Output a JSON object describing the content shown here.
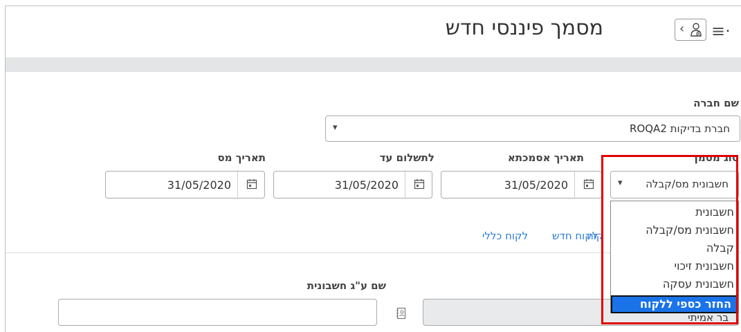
{
  "header": {
    "title": "מסמך פיננסי חדש",
    "menu_icon": "hamburger-menu-icon",
    "customer_icon": "person-add-icon"
  },
  "form": {
    "company": {
      "label": "שם חברה",
      "value": "חברת בדיקות ROQA2"
    },
    "doc_type": {
      "label": "סוג מסמך",
      "value": "חשבונית מס/קבלה"
    },
    "ref_date": {
      "label": "תאריך אסמכתא",
      "value": "31/05/2020"
    },
    "due_date": {
      "label": "לתשלום עד",
      "value": "31/05/2020"
    },
    "tax_date": {
      "label": "תאריך מס",
      "value": "31/05/2020"
    },
    "links": {
      "new_customer": "לקוח חדש",
      "general_customer": "לקוח כללי",
      "partial": "קוח"
    },
    "invoice_name": {
      "label": "שם ע\"ג חשבונית",
      "value": ""
    },
    "customer_field": {
      "value": "בר אמיתי"
    }
  },
  "dropdown": {
    "options": [
      "חשבונית",
      "חשבונית מס/קבלה",
      "קבלה",
      "חשבונית זיכוי",
      "חשבונית עסקה"
    ],
    "highlighted": "החזר כספי ללקוח"
  },
  "colors": {
    "accent": "#2a7bd6",
    "highlight": "#1a73e8",
    "annotation": "#e00000"
  }
}
